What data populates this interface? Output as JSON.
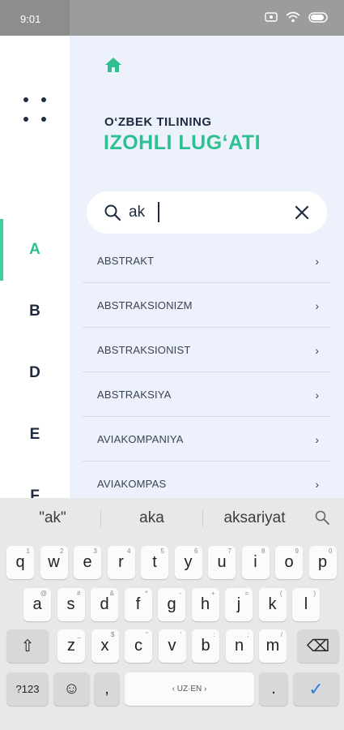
{
  "status": {
    "time": "9:01"
  },
  "sidebar": {
    "letters": [
      "A",
      "B",
      "D",
      "E",
      "F"
    ],
    "active": "A"
  },
  "header": {
    "line1": "O‘ZBEK TILINING",
    "line2": "IZOHLI LUG‘ATI"
  },
  "search": {
    "value": "ak",
    "placeholder": ""
  },
  "results": [
    {
      "label": "ABSTRAKT"
    },
    {
      "label": "ABSTRAKSIONIZM"
    },
    {
      "label": "ABSTRAKSIONIST"
    },
    {
      "label": "ABSTRAKSIYA"
    },
    {
      "label": "AVIAKOMPANIYA"
    },
    {
      "label": "AVIAKOMPAS"
    }
  ],
  "chevron": "›",
  "keyboard": {
    "suggestions": [
      "\"ak\"",
      "aka",
      "aksariyat"
    ],
    "row1": [
      {
        "k": "q",
        "h": "1"
      },
      {
        "k": "w",
        "h": "2"
      },
      {
        "k": "e",
        "h": "3"
      },
      {
        "k": "r",
        "h": "4"
      },
      {
        "k": "t",
        "h": "5"
      },
      {
        "k": "y",
        "h": "6"
      },
      {
        "k": "u",
        "h": "7"
      },
      {
        "k": "i",
        "h": "8"
      },
      {
        "k": "o",
        "h": "9"
      },
      {
        "k": "p",
        "h": "0"
      }
    ],
    "row2": [
      {
        "k": "a",
        "h": "@"
      },
      {
        "k": "s",
        "h": "#"
      },
      {
        "k": "d",
        "h": "&"
      },
      {
        "k": "f",
        "h": "*"
      },
      {
        "k": "g",
        "h": "-"
      },
      {
        "k": "h",
        "h": "+"
      },
      {
        "k": "j",
        "h": "="
      },
      {
        "k": "k",
        "h": "("
      },
      {
        "k": "l",
        "h": ")"
      }
    ],
    "row3": [
      {
        "k": "z",
        "h": "_"
      },
      {
        "k": "x",
        "h": "$"
      },
      {
        "k": "c",
        "h": "\""
      },
      {
        "k": "v",
        "h": "'"
      },
      {
        "k": "b",
        "h": ":"
      },
      {
        "k": "n",
        "h": ";"
      },
      {
        "k": "m",
        "h": "/"
      }
    ],
    "shift": "⇧",
    "backspace": "⌫",
    "symbols": "?123",
    "emoji": "☺",
    "comma": ",",
    "space": "‹ UZ·EN ›",
    "period": ".",
    "enter": "✓"
  },
  "colors": {
    "accent": "#2ec090",
    "dark": "#1e2a3f",
    "panel": "#edf1fb"
  }
}
